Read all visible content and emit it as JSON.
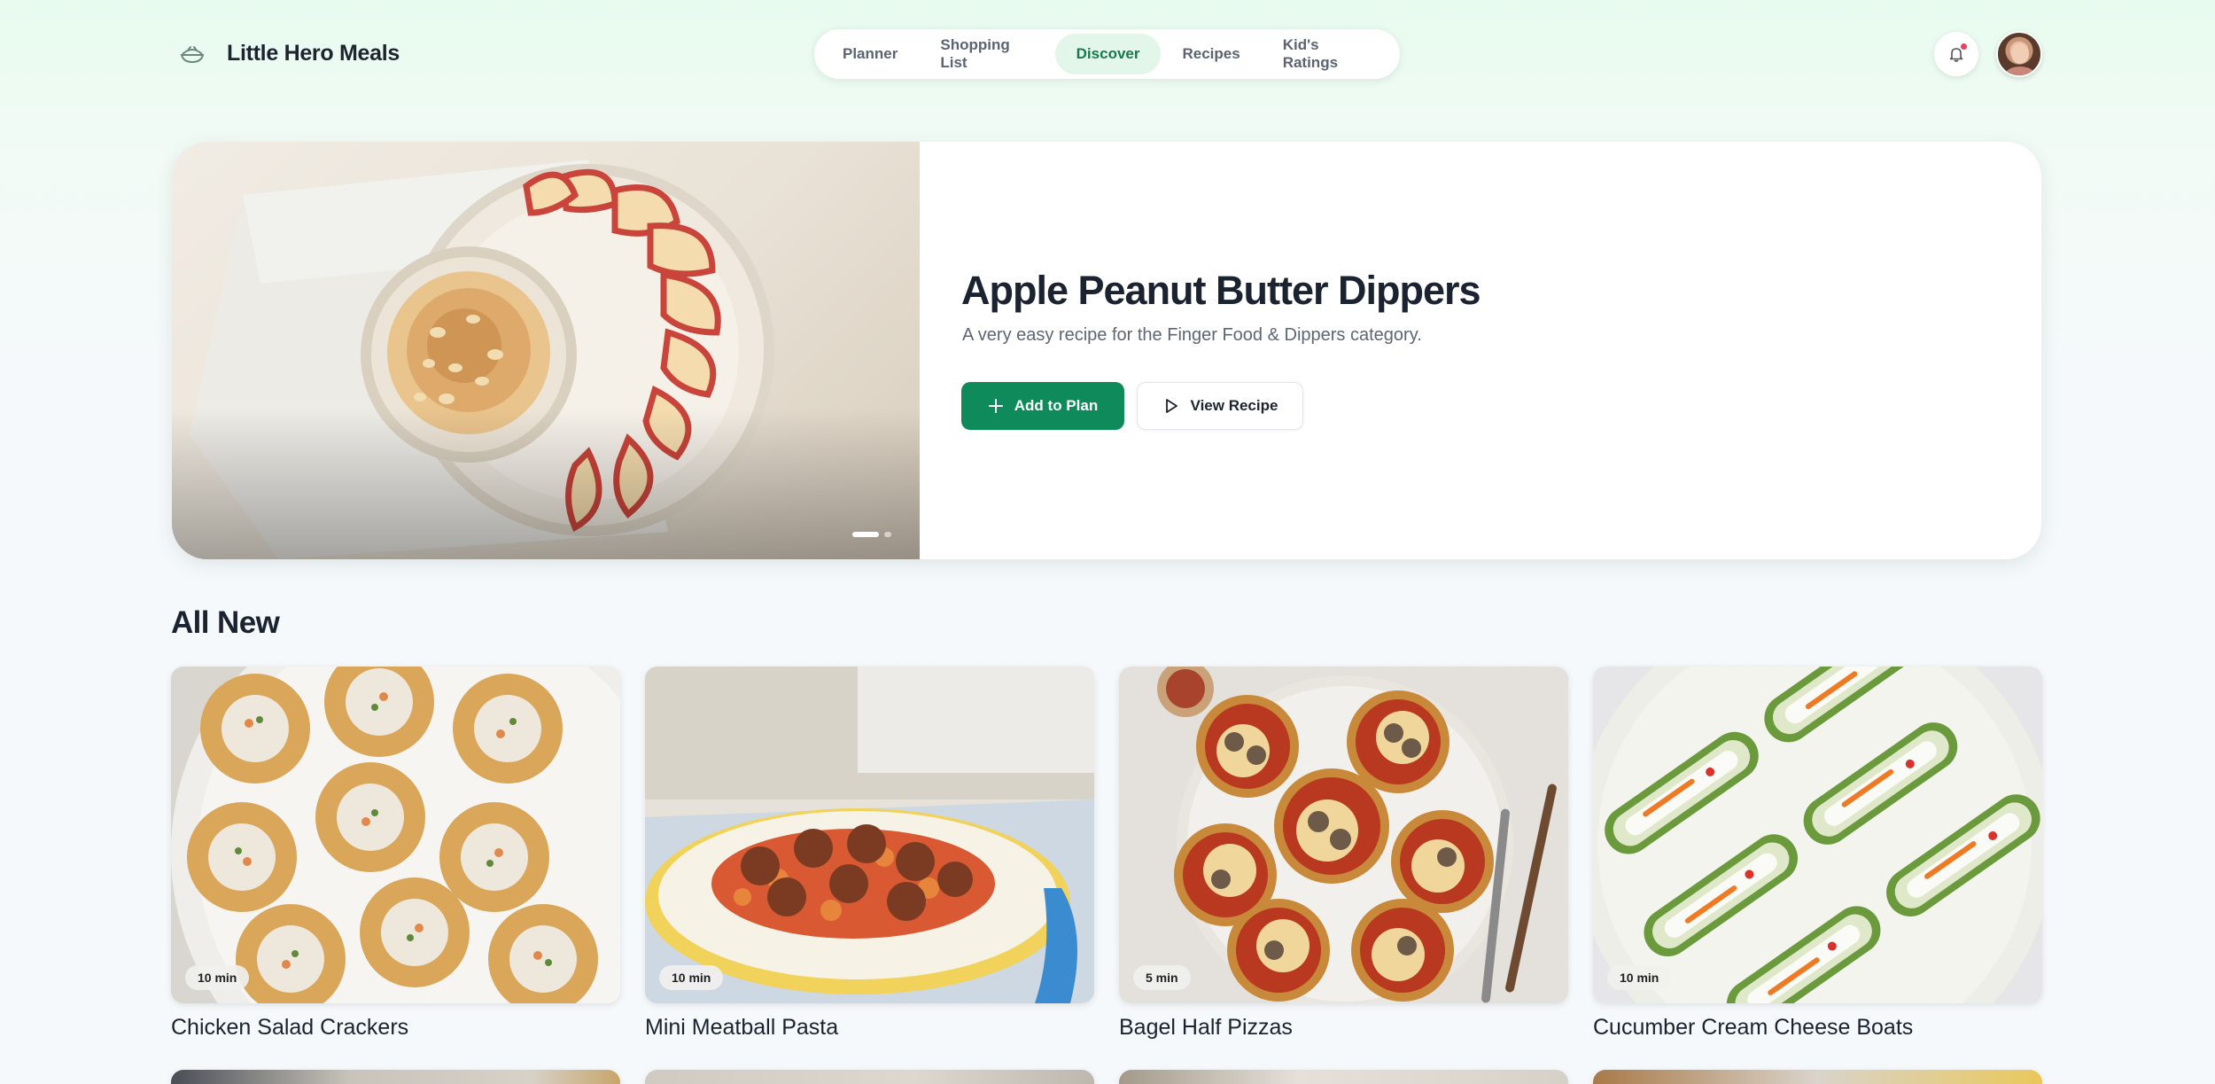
{
  "brand": {
    "name": "Little Hero Meals",
    "icon": "shield-bowl-icon"
  },
  "nav": {
    "items": [
      {
        "label": "Planner"
      },
      {
        "label": "Shopping List"
      },
      {
        "label": "Discover",
        "active": true
      },
      {
        "label": "Recipes"
      },
      {
        "label": "Kid's Ratings"
      }
    ]
  },
  "header": {
    "notifications_icon": "bell-icon",
    "avatar": "user-avatar"
  },
  "hero": {
    "title": "Apple Peanut Butter Dippers",
    "subtitle": "A very easy recipe for the Finger Food & Dippers category.",
    "primary_button": "Add to Plan",
    "secondary_button": "View Recipe",
    "slides_total": 2,
    "slide_active": 1
  },
  "section": {
    "title": "All New",
    "cards": [
      {
        "title": "Chicken Salad Crackers",
        "time": "10 min"
      },
      {
        "title": "Mini Meatball Pasta",
        "time": "10 min"
      },
      {
        "title": "Bagel Half Pizzas",
        "time": "5 min"
      },
      {
        "title": "Cucumber Cream Cheese Boats",
        "time": "10 min"
      }
    ]
  },
  "colors": {
    "accent": "#0f8a5a",
    "nav_active_bg": "#e3f6ea",
    "nav_active_text": "#177a4b"
  }
}
